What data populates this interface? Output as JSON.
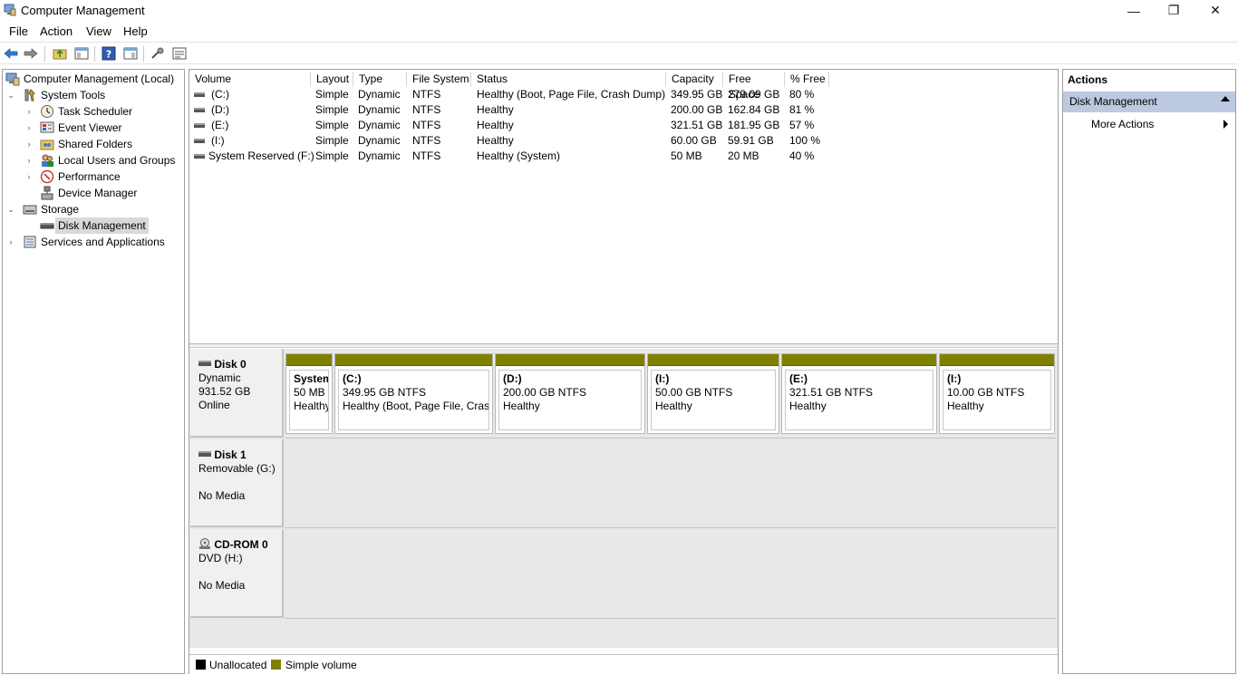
{
  "window": {
    "title": "Computer Management",
    "minimize": "—",
    "restore": "❐",
    "close": "✕"
  },
  "menu": [
    "File",
    "Action",
    "View",
    "Help"
  ],
  "tree": {
    "root": "Computer Management (Local)",
    "system_tools": "System Tools",
    "task_scheduler": "Task Scheduler",
    "event_viewer": "Event Viewer",
    "shared_folders": "Shared Folders",
    "local_users": "Local Users and Groups",
    "performance": "Performance",
    "device_manager": "Device Manager",
    "storage": "Storage",
    "disk_management": "Disk Management",
    "services": "Services and Applications"
  },
  "volume_table": {
    "headers": [
      "Volume",
      "Layout",
      "Type",
      "File System",
      "Status",
      "Capacity",
      "Free Space",
      "% Free"
    ],
    "rows": [
      [
        "(C:)",
        "Simple",
        "Dynamic",
        "NTFS",
        "Healthy (Boot, Page File, Crash Dump)",
        "349.95 GB",
        "279.09 GB",
        "80 %"
      ],
      [
        "(D:)",
        "Simple",
        "Dynamic",
        "NTFS",
        "Healthy",
        "200.00 GB",
        "162.84 GB",
        "81 %"
      ],
      [
        "(E:)",
        "Simple",
        "Dynamic",
        "NTFS",
        "Healthy",
        "321.51 GB",
        "181.95 GB",
        "57 %"
      ],
      [
        "(I:)",
        "Simple",
        "Dynamic",
        "NTFS",
        "Healthy",
        "60.00 GB",
        "59.91 GB",
        "100 %"
      ],
      [
        "System Reserved (F:)",
        "Simple",
        "Dynamic",
        "NTFS",
        "Healthy (System)",
        "50 MB",
        "20 MB",
        "40 %"
      ]
    ]
  },
  "disks": {
    "disk0": {
      "name": "Disk 0",
      "type": "Dynamic",
      "size": "931.52 GB",
      "status": "Online",
      "partitions": [
        {
          "name": "System",
          "size": "50 MB NTFS",
          "status": "Healthy (System)"
        },
        {
          "name": "(C:)",
          "size": "349.95 GB NTFS",
          "status": "Healthy (Boot, Page File, Crash Dump)"
        },
        {
          "name": "(D:)",
          "size": "200.00 GB NTFS",
          "status": "Healthy"
        },
        {
          "name": "(I:)",
          "size": "50.00 GB NTFS",
          "status": "Healthy"
        },
        {
          "name": "(E:)",
          "size": "321.51 GB NTFS",
          "status": "Healthy"
        },
        {
          "name": "(I:)",
          "size": "10.00 GB NTFS",
          "status": "Healthy"
        }
      ]
    },
    "disk1": {
      "name": "Disk 1",
      "type": "Removable (G:)",
      "status": "No Media"
    },
    "cdrom0": {
      "name": "CD-ROM 0",
      "type": "DVD (H:)",
      "status": "No Media"
    }
  },
  "legend": {
    "unallocated": "Unallocated",
    "simple": "Simple volume",
    "unallocated_color": "#000000",
    "simple_color": "#808000"
  },
  "actions": {
    "title": "Actions",
    "section": "Disk Management",
    "more": "More Actions"
  }
}
